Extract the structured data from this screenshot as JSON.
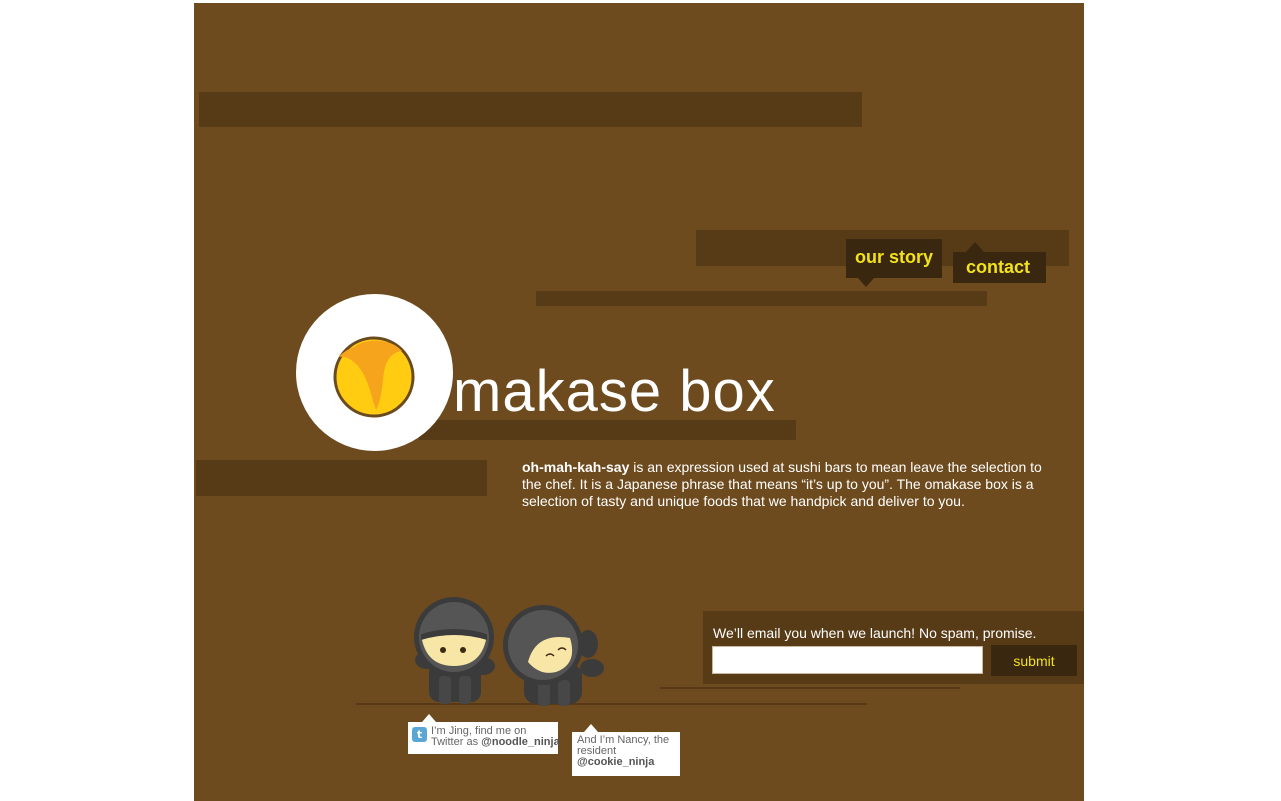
{
  "nav": {
    "our_story": "our story",
    "contact": "contact"
  },
  "brand": {
    "name": "makase box",
    "logo_letter_icon": "orange-circle-o-icon"
  },
  "intro": {
    "term": "oh-mah-kah-say",
    "text": " is an expression used at sushi bars to mean leave the selection to the chef.  It is a Japanese phrase that means “it’s up to you”.  The omakase box is a selection of tasty and unique foods that we handpick and deliver to you."
  },
  "ninjas": {
    "jing": {
      "line1": "I’m Jing, find me on",
      "line2_prefix": "Twitter as ",
      "handle": "@noodle_ninja",
      "icon": "twitter-icon"
    },
    "nancy": {
      "line1": "And I’m Nancy, the",
      "line2": "resident",
      "handle": "@cookie_ninja"
    }
  },
  "signup": {
    "label": "We’ll email you when we launch! No spam, promise.",
    "email_value": "",
    "email_placeholder": "",
    "submit_label": "submit"
  },
  "colors": {
    "background": "#6e4b1e",
    "bar": "#573a16",
    "nav_bg": "#3a2710",
    "accent_yellow": "#f2e21a",
    "logo_orange": "#f7a41d",
    "logo_yellow": "#ffcc12"
  }
}
